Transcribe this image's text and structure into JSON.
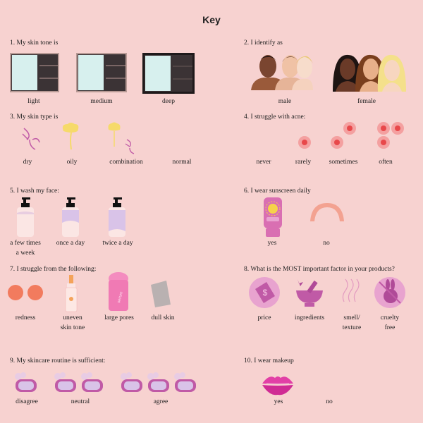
{
  "title": "Key",
  "q1": {
    "question": "1. My skin tone is",
    "options": [
      "light",
      "medium",
      "deep"
    ]
  },
  "q2": {
    "question": "2. I identify as",
    "options": [
      "male",
      "female"
    ]
  },
  "q3": {
    "question": "3. My skin type is",
    "options": [
      "dry",
      "oily",
      "combination",
      "normal"
    ]
  },
  "q4": {
    "question": "4. I struggle with acne:",
    "options": [
      "never",
      "rarely",
      "sometimes",
      "often"
    ]
  },
  "q5": {
    "question": "5. I wash my face:",
    "options": [
      "a few times\na week",
      "once a day",
      "twice a day"
    ]
  },
  "q6": {
    "question": "6. I wear sunscreen daily",
    "options": [
      "yes",
      "no"
    ]
  },
  "q7": {
    "question": "7. I struggle from the following:",
    "options": [
      "redness",
      "uneven\nskin tone",
      "large pores",
      "dull skin"
    ]
  },
  "q8": {
    "question": "8. What is the MOST important factor in your products?",
    "options": [
      "price",
      "ingredients",
      "smell/\ntexture",
      "cruelty\nfree"
    ]
  },
  "q9": {
    "question": "9. My skincare routine is sufficient:",
    "options": [
      "disagree",
      "neutral",
      "agree"
    ]
  },
  "q10": {
    "question": "10. I wear makeup",
    "options": [
      "yes",
      "no"
    ]
  },
  "colors": {
    "background": "#f7d2d0",
    "accent_pink": "#d96fb2",
    "acne_red": "#e8484a",
    "frame_dark": "#4a3a38",
    "mirror": "#d7f0ee"
  }
}
